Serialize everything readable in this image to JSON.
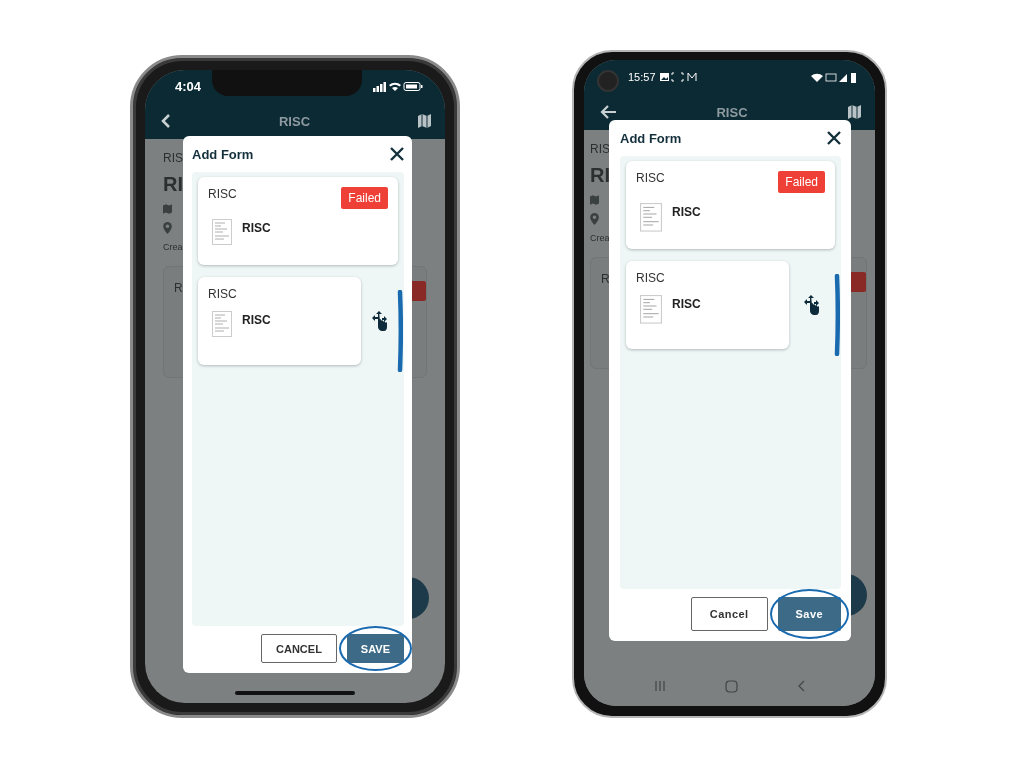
{
  "phones": [
    {
      "kind": "ios",
      "status_bar": {
        "time": "4:04"
      },
      "app_bar": {
        "title": "RISC"
      },
      "background": {
        "caption": "RIS",
        "heading": "RI",
        "meta": "Crea",
        "card_label": "R"
      },
      "dialog": {
        "title": "Add Form",
        "forms": [
          {
            "label": "RISC",
            "name": "RISC",
            "badge": "Failed",
            "dragging": false
          },
          {
            "label": "RISC",
            "name": "RISC",
            "dragging": true
          }
        ],
        "buttons": [
          {
            "label": "CANCEL",
            "kind": "outlined",
            "highlighted": false
          },
          {
            "label": "SAVE",
            "kind": "primary",
            "highlighted": true
          }
        ]
      }
    },
    {
      "kind": "android",
      "status_bar": {
        "time": "15:57"
      },
      "app_bar": {
        "title": "RISC"
      },
      "background": {
        "caption": "RIS",
        "heading": "RI",
        "meta": "Crea",
        "card_label": "R"
      },
      "dialog": {
        "title": "Add Form",
        "forms": [
          {
            "label": "RISC",
            "name": "RISC",
            "badge": "Failed",
            "dragging": false
          },
          {
            "label": "RISC",
            "name": "RISC",
            "dragging": true
          }
        ],
        "buttons": [
          {
            "label": "Cancel",
            "kind": "outlined",
            "highlighted": false
          },
          {
            "label": "Save",
            "kind": "primary",
            "highlighted": true
          }
        ]
      }
    }
  ]
}
